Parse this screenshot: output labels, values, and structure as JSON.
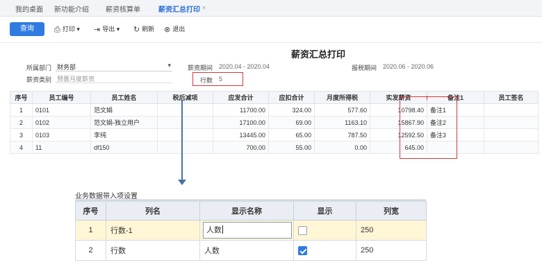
{
  "tabs": [
    {
      "label": "我的桌面"
    },
    {
      "label": "新功能介绍"
    },
    {
      "label": "薪资核算单"
    },
    {
      "label": "薪资汇总打印",
      "active": true
    }
  ],
  "tab_close": "×",
  "toolbar": {
    "query": "查询",
    "print": "打印",
    "export": "导出",
    "refresh": "刷新",
    "exit": "退出"
  },
  "report": {
    "title": "薪资汇总打印",
    "dept_label": "所属部门",
    "dept_value": "财务部",
    "period_label": "薪资期间",
    "period_value": "2020.04 - 2020.04",
    "tax_period_label": "报税期间",
    "tax_period_value": "2020.06 - 2020.06",
    "type_label": "薪资类别",
    "type_value": "预置月度薪资",
    "rowcount_label": "行数",
    "rowcount_value": "5"
  },
  "grid": {
    "headers": [
      "序号",
      "员工编号",
      "员工姓名",
      "税后减项",
      "应发合计",
      "应扣合计",
      "月度所得税",
      "实发薪资",
      "备注1",
      "员工签名"
    ],
    "rows": [
      [
        "1",
        "0101",
        "范文娟",
        "",
        "11700.00",
        "324.00",
        "577.60",
        "10798.40",
        "备注1",
        ""
      ],
      [
        "2",
        "0102",
        "范文娟-独立用户",
        "",
        "17100.00",
        "69.00",
        "1163.10",
        "15867.90",
        "备注2",
        ""
      ],
      [
        "3",
        "0103",
        "李纯",
        "",
        "13445.00",
        "65.00",
        "787.50",
        "12592.50",
        "备注3",
        ""
      ],
      [
        "4",
        "11",
        "df150",
        "",
        "700.00",
        "55.00",
        "0.00",
        "645.00",
        "",
        ""
      ]
    ]
  },
  "settings": {
    "title": "业务数据带入项设置",
    "headers": [
      "序号",
      "列名",
      "显示名称",
      "显示",
      "列宽"
    ],
    "rows": [
      {
        "no": "1",
        "col": "行数-1",
        "display": "人数",
        "show": false,
        "width": "250"
      },
      {
        "no": "2",
        "col": "行数",
        "display": "人数",
        "show": true,
        "width": "250"
      }
    ]
  },
  "colors": {
    "accent": "#2f7be0",
    "annotation": "#d0383b",
    "arrow": "#4a72a8"
  }
}
